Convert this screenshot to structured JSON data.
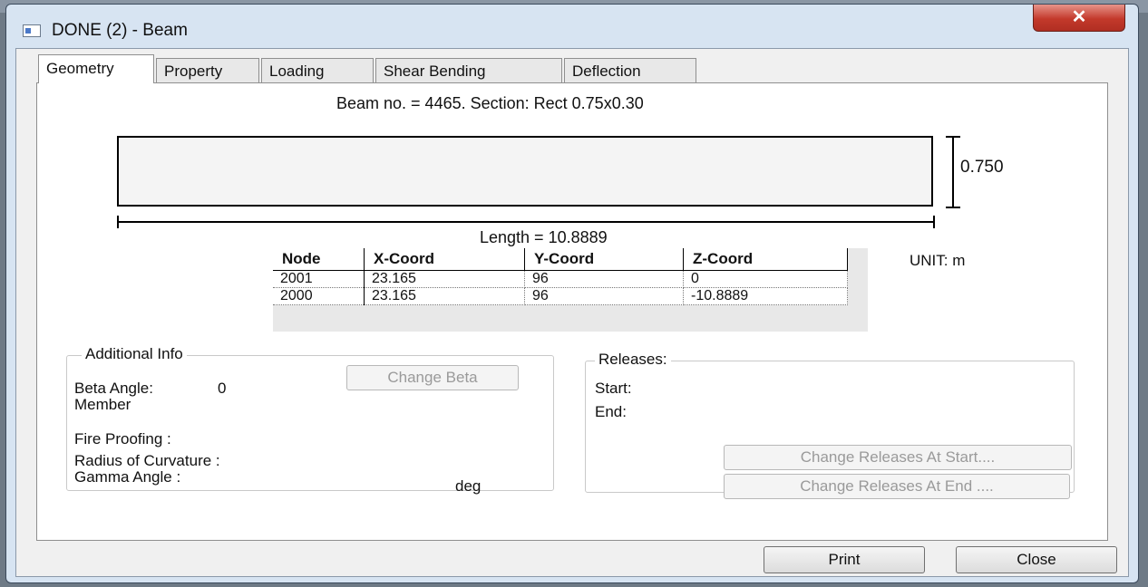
{
  "window": {
    "title": "DONE (2) - Beam",
    "close_glyph": "✕"
  },
  "tabs": [
    "Geometry",
    "Property",
    "Loading",
    "Shear Bending",
    "Deflection"
  ],
  "active_tab": "Geometry",
  "geometry": {
    "beam_title": "Beam no. = 4465. Section: Rect 0.75x0.30",
    "height_label": "0.750",
    "length_label": "Length = 10.8889",
    "unit_label": "UNIT: m",
    "table": {
      "headers": [
        "Node",
        "X-Coord",
        "Y-Coord",
        "Z-Coord"
      ],
      "rows": [
        [
          "2001",
          "23.165",
          "96",
          "0"
        ],
        [
          "2000",
          "23.165",
          "96",
          "-10.8889"
        ]
      ]
    }
  },
  "additional_info": {
    "title": "Additional Info",
    "beta_angle_label": "Beta Angle:",
    "beta_angle_value": "0",
    "member_label": "Member",
    "change_beta_label": "Change Beta",
    "fire_proofing_label": "Fire Proofing :",
    "radius_label": "Radius of Curvature :",
    "gamma_label": "Gamma Angle :",
    "gamma_unit": "deg"
  },
  "releases": {
    "title": "Releases:",
    "start_label": "Start:",
    "end_label": "End:",
    "change_start_label": "Change Releases At Start....",
    "change_end_label": "Change Releases At End ...."
  },
  "footer": {
    "print_label": "Print",
    "close_label": "Close"
  },
  "colors": {
    "titlebar": "#d7e4f2",
    "close_button": "#c3392b"
  }
}
